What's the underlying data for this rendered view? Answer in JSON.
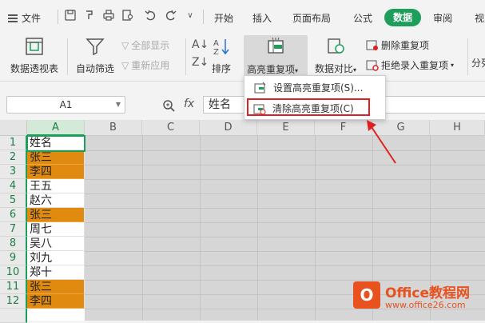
{
  "menu": {
    "file_label": "文件",
    "tabs": [
      "开始",
      "插入",
      "页面布局",
      "公式",
      "数据",
      "审阅"
    ],
    "active_tab": "数据"
  },
  "ribbon": {
    "pivot": "数据透视表",
    "autofilter": "自动筛选",
    "show_all": "全部显示",
    "reapply": "重新应用",
    "sort": "排序",
    "highlight_dup": "高亮重复项",
    "data_compare": "数据对比",
    "delete_dup": "删除重复项",
    "reject_dup": "拒绝录入重复项",
    "split": "分列",
    "dropdown_arrow": "▾"
  },
  "dropdown": {
    "set_highlight": "设置高亮重复项(S)...",
    "clear_highlight": "清除高亮重复项(C)"
  },
  "formula_bar": {
    "cell_ref": "A1",
    "fx": "fx",
    "value": "姓名"
  },
  "grid": {
    "columns": [
      "A",
      "B",
      "C",
      "D",
      "E",
      "F",
      "G",
      "H"
    ],
    "rows": [
      {
        "num": "1",
        "value": "姓名",
        "dup": false
      },
      {
        "num": "2",
        "value": "张三",
        "dup": true
      },
      {
        "num": "3",
        "value": "李四",
        "dup": true
      },
      {
        "num": "4",
        "value": "王五",
        "dup": false
      },
      {
        "num": "5",
        "value": "赵六",
        "dup": false
      },
      {
        "num": "6",
        "value": "张三",
        "dup": true
      },
      {
        "num": "7",
        "value": "周七",
        "dup": false
      },
      {
        "num": "8",
        "value": "吴八",
        "dup": false
      },
      {
        "num": "9",
        "value": "刘九",
        "dup": false
      },
      {
        "num": "10",
        "value": "郑十",
        "dup": false
      },
      {
        "num": "11",
        "value": "张三",
        "dup": true
      },
      {
        "num": "12",
        "value": "李四",
        "dup": true
      }
    ]
  },
  "colors": {
    "accent": "#1e9e5b",
    "duplicate_fill": "#e08a10",
    "annotation": "#e02020"
  },
  "watermark": {
    "logo_letter": "O",
    "title": "Office教程网",
    "url": "www.office26.com"
  }
}
